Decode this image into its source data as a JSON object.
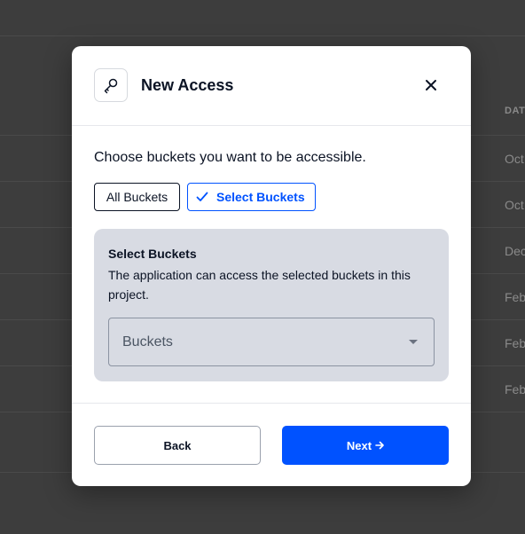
{
  "background": {
    "column_header": "DAT",
    "rows": [
      "Oct",
      "Oct",
      "Dec",
      "Feb",
      "Feb",
      "Feb"
    ]
  },
  "modal": {
    "title": "New Access",
    "header_icon": "key-icon",
    "close_icon": "close-icon",
    "prompt": "Choose buckets you want to be accessible.",
    "scope_options": {
      "all": "All Buckets",
      "select": "Select Buckets",
      "selected": "select"
    },
    "panel": {
      "title": "Select Buckets",
      "description": "The application can access the selected buckets in this project.",
      "dropdown_placeholder": "Buckets"
    },
    "footer": {
      "back_label": "Back",
      "next_label": "Next",
      "next_icon": "arrow-right-icon"
    }
  },
  "colors": {
    "primary": "#0052ff",
    "panel_bg": "#d8dbe3",
    "overlay_bg": "#3d3d3d"
  }
}
